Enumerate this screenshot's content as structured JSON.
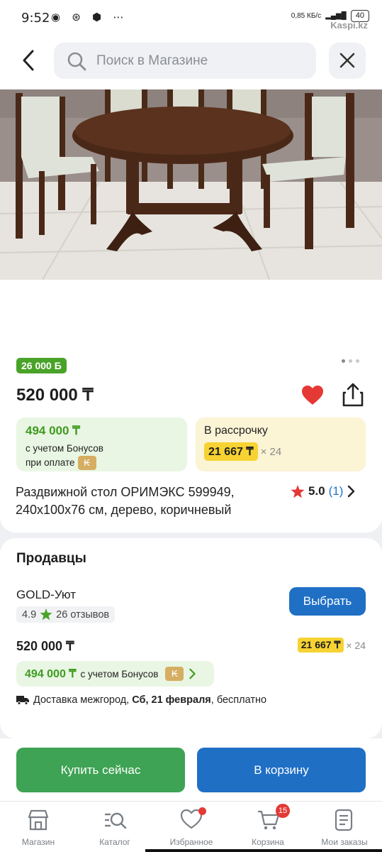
{
  "status_bar": {
    "time": "9:52",
    "speed": "0,85 КБ/с",
    "battery": "40",
    "watermark": "Kaspi.kz"
  },
  "search": {
    "placeholder": "Поиск в Магазине"
  },
  "product": {
    "bonus_badge": "26 000 Б",
    "price": "520 000 ₸",
    "bonus_price": "494 000 ₸",
    "bonus_note_line1": "с учетом Бонусов",
    "bonus_note_line2": "при оплате",
    "installment_title": "В рассрочку",
    "installment_amount": "21 667 ₸",
    "installment_term": "× 24",
    "name": "Раздвижной стол ОРИМЭКС 599949, 240х100х76 см, дерево, коричневый",
    "rating": "5.0",
    "reviews_count": "(1)"
  },
  "sellers": {
    "title": "Продавцы",
    "seller_name": "GOLD-Уют",
    "seller_rating": "4.9",
    "seller_reviews": "26 отзывов",
    "choose_label": "Выбрать",
    "price": "520 000 ₸",
    "installment_amount": "21 667 ₸",
    "installment_term": "× 24",
    "bonus_price": "494 000 ₸",
    "bonus_note": "с учетом Бонусов",
    "delivery_prefix": "Доставка межгород, ",
    "delivery_date": "Сб, 21 февраля",
    "delivery_suffix": ", бесплатно"
  },
  "actions": {
    "buy_now": "Купить сейчас",
    "to_cart": "В корзину"
  },
  "tabbar": {
    "items": [
      {
        "label": "Магазин",
        "icon": "store-icon"
      },
      {
        "label": "Каталог",
        "icon": "catalog-search-icon"
      },
      {
        "label": "Избранное",
        "icon": "heart-outline-icon"
      },
      {
        "label": "Корзина",
        "icon": "cart-icon",
        "badge": "15"
      },
      {
        "label": "Мои заказы",
        "icon": "orders-icon"
      }
    ]
  },
  "colors": {
    "accent_blue": "#1f6fc5",
    "bonus_green": "#4aa329",
    "buy_green": "#3ea354",
    "installment_yellow": "#f6d332",
    "heart_red": "#e53935"
  }
}
